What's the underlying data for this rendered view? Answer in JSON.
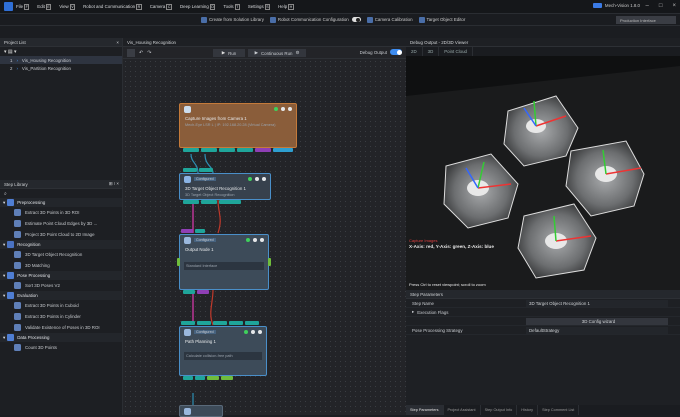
{
  "menu": {
    "items": [
      {
        "label": "File",
        "key": "F"
      },
      {
        "label": "Edit",
        "key": "E"
      },
      {
        "label": "View",
        "key": "V"
      },
      {
        "label": "Robot and Communication",
        "key": "R"
      },
      {
        "label": "Camera",
        "key": "C"
      },
      {
        "label": "Deep Learning",
        "key": "D"
      },
      {
        "label": "Tools",
        "key": "T"
      },
      {
        "label": "Settings",
        "key": "S"
      },
      {
        "label": "Help",
        "key": "H"
      }
    ],
    "brand": "Mech-Vision 1.8.0"
  },
  "toolbar": {
    "create": "Create from Solution Library",
    "robot_comm": "Robot Communication Configuration",
    "camera_cal": "Camera Calibration",
    "target_editor": "Target Object Editor",
    "production": "Production Interface"
  },
  "project_list": {
    "title": "Project List",
    "items": [
      {
        "num": "1",
        "name": "Vis_Housing Recognition"
      },
      {
        "num": "2",
        "name": "Vis_Partition Recognition"
      }
    ]
  },
  "step_library": {
    "title": "Step Library",
    "categories": [
      {
        "name": "Preprocessing",
        "color": "#4f7ed3",
        "steps": [
          "Extract 3D Points in 3D ROI",
          "Estimate Point Cloud Edges by 3D ...",
          "Project 3D Point Cloud to 2D Image"
        ]
      },
      {
        "name": "Recognition",
        "color": "#4a72c2",
        "steps": [
          "3D Target Object Recognition",
          "3D Matching"
        ]
      },
      {
        "name": "Pose Processing",
        "color": "#4f7ed3",
        "steps": [
          "Sort 3D Poses V2"
        ]
      },
      {
        "name": "Evaluation",
        "color": "#4f7ed3",
        "steps": [
          "Extract 3D Points in Cuboid",
          "Extract 3D Points in Cylinder",
          "Validate Existence of Poses in 3D ROI"
        ]
      },
      {
        "name": "Data Processing",
        "color": "#4f7ed3",
        "steps": [
          "Count 3D Points"
        ]
      }
    ]
  },
  "editor": {
    "tab": "Vis_Housing Recognition",
    "run": "Run",
    "continuous_run": "Continuous Run",
    "debug_output": "Debug Output",
    "nodes": [
      {
        "title": "Capture Images from Camera 1",
        "sub": "Mech-Eye LSR L | IP: 192.168.20.28 (Virtual Camera)",
        "color": "#7a5a3a",
        "border": "#b07a3e"
      },
      {
        "title": "3D Target Object Recognition 1",
        "sub": "3D Target Object Recognition",
        "color": "#3b4656",
        "border": "#4a8fc9",
        "badge": "Configured"
      },
      {
        "title": "Output Node 1",
        "sub": "Standard Interface",
        "color": "#3b4b5b",
        "border": "#4a8fc9",
        "badge": "Configured"
      },
      {
        "title": "Path Planning 1",
        "sub": "Calculate collision-free path",
        "color": "#3b4b5b",
        "border": "#4a8fc9",
        "badge": "Configured"
      }
    ]
  },
  "viewer": {
    "title": "Debug Output - 2D/3D Viewer",
    "tabs": [
      "2D",
      "3D",
      "Point Cloud"
    ],
    "caption_red": "Capture Images",
    "caption": "X-Axis: red, Y-Axis: green, Z-Axis: blue",
    "hint": "Press Ctrl to reset viewpoint; scroll to zoom",
    "zoom": "100%"
  },
  "params": {
    "header": "Step Parameters",
    "step_name_label": "Step Name",
    "step_name_value": "3D Target Object Recognition 1",
    "execution_flags": "Execution Flags",
    "config_wizard": "3D Config wizard",
    "strategy_label": "Pose Processing Strategy",
    "strategy_value": "DefaultStrategy"
  },
  "bottom_tabs": [
    "Step Parameters",
    "Project Assistant",
    "Step Output Info",
    "History",
    "Step Comment List"
  ]
}
